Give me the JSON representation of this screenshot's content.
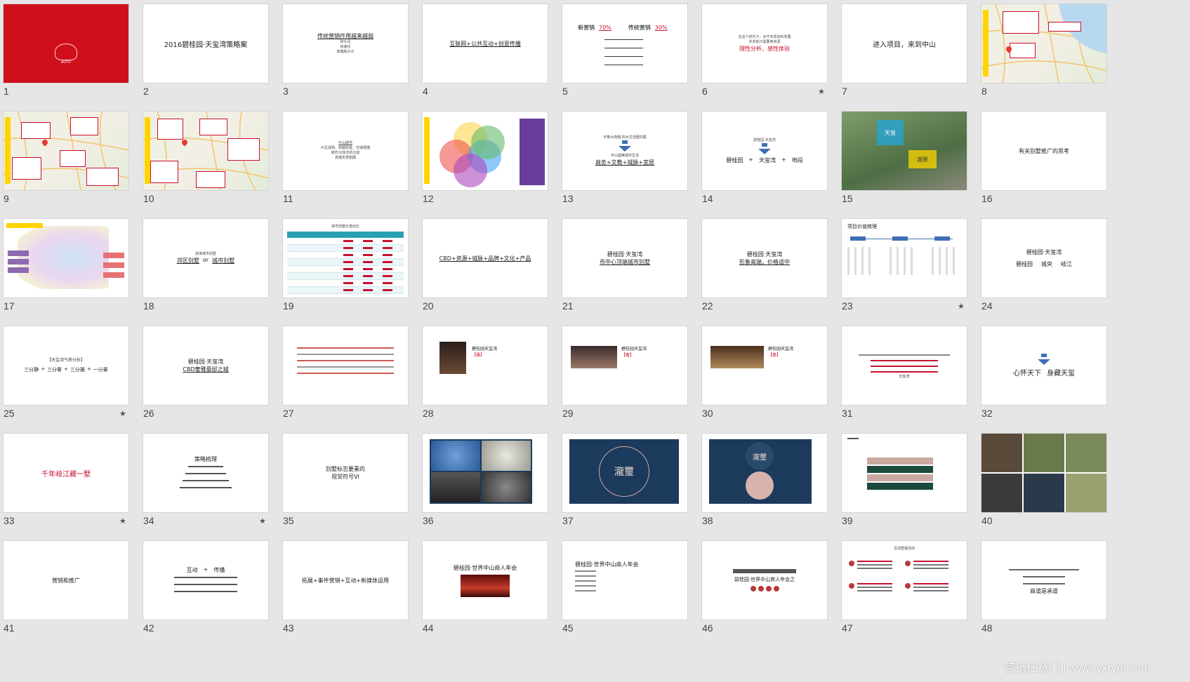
{
  "watermark": "营销任意门 | www.yxrym.com",
  "colors": {
    "background": "#e6e6e6",
    "red": "#c8102e",
    "navy": "#1c3a5c",
    "accent_blue": "#3f6fb5"
  },
  "slides": [
    {
      "n": "1",
      "lines": [
        "AUTO"
      ],
      "star": ""
    },
    {
      "n": "2",
      "lines": [
        "2016碧桂园·天玺湾策略案"
      ],
      "star": ""
    },
    {
      "n": "3",
      "lines": [
        "传统营销作用越来越弱",
        "碎片化",
        "快速化",
        "高端和大众"
      ],
      "star": ""
    },
    {
      "n": "4",
      "lines": [
        "互联网+公共互动+创意传播"
      ],
      "star": ""
    },
    {
      "n": "5",
      "lines": [
        "新营销",
        "70%",
        "传统营销",
        "30%"
      ],
      "star": ""
    },
    {
      "n": "6",
      "lines": [
        "在这个时代下，对于本项目的发展",
        "并非就只需要卖资源",
        "理性分析，感性体验"
      ],
      "star": "★"
    },
    {
      "n": "7",
      "lines": [
        "进入项目，来到中山"
      ],
      "star": ""
    },
    {
      "n": "8",
      "lines": [],
      "star": ""
    },
    {
      "n": "9",
      "lines": [],
      "star": ""
    },
    {
      "n": "10",
      "lines": [],
      "star": ""
    },
    {
      "n": "11",
      "lines": [
        "中山城市",
        "片区成熟、商圈完善、交通便捷",
        "城市10多年的沉淀",
        "高端无限拓展"
      ],
      "star": ""
    },
    {
      "n": "12",
      "lines": [],
      "star": ""
    },
    {
      "n": "13",
      "lines": [
        "平衡大商圈·四大生活圈交集",
        "中山首席城市生活",
        "商务+文教+城脉+宜居"
      ],
      "star": ""
    },
    {
      "n": "14",
      "lines": [
        "碧桂园·天玺湾",
        "碧桂园",
        "+",
        "天玺湾",
        "+",
        "地段"
      ],
      "star": ""
    },
    {
      "n": "15",
      "lines": [
        "天玺",
        "湖景"
      ],
      "star": ""
    },
    {
      "n": "16",
      "lines": [
        "有关别墅推广的思考"
      ],
      "star": ""
    },
    {
      "n": "17",
      "lines": [],
      "star": ""
    },
    {
      "n": "18",
      "lines": [
        "找准城市别墅",
        "郊区别墅",
        "or",
        "城市别墅"
      ],
      "star": ""
    },
    {
      "n": "19",
      "lines": [
        "城市别墅价值对比"
      ],
      "star": ""
    },
    {
      "n": "20",
      "lines": [
        "CBD+资源+城脉+品牌+文化+产品"
      ],
      "star": ""
    },
    {
      "n": "21",
      "lines": [
        "碧桂园·天玺湾",
        "市中心顶端城市别墅"
      ],
      "star": ""
    },
    {
      "n": "22",
      "lines": [
        "碧桂园·天玺湾",
        "形象高端，价格适中"
      ],
      "star": ""
    },
    {
      "n": "23",
      "lines": [
        "项目价值梳理"
      ],
      "star": "★"
    },
    {
      "n": "24",
      "lines": [
        "碧桂园·天玺湾",
        "碧桂园",
        "城央",
        "岐江"
      ],
      "star": ""
    },
    {
      "n": "25",
      "lines": [
        "【天玺湾气质分析】",
        "三分静",
        "+",
        "三分奢",
        "+",
        "三分雅",
        "+",
        "一分豪"
      ],
      "star": "★"
    },
    {
      "n": "26",
      "lines": [
        "碧桂园·天玺湾",
        "CBD奢雅豪邸之城"
      ],
      "star": ""
    },
    {
      "n": "27",
      "lines": [],
      "star": ""
    },
    {
      "n": "28",
      "lines": [
        "碧桂园天玺湾",
        "【雅】"
      ],
      "star": ""
    },
    {
      "n": "29",
      "lines": [
        "碧桂园天玺湾",
        "【奢】"
      ],
      "star": ""
    },
    {
      "n": "30",
      "lines": [
        "碧桂园天玺湾",
        "【豪】"
      ],
      "star": ""
    },
    {
      "n": "31",
      "lines": [
        "天玺湾"
      ],
      "star": ""
    },
    {
      "n": "32",
      "lines": [
        "心怀天下",
        "身藏天玺"
      ],
      "star": ""
    },
    {
      "n": "33",
      "lines": [
        "千年岐江藏一墅"
      ],
      "star": "★"
    },
    {
      "n": "34",
      "lines": [
        "策略梳理"
      ],
      "star": "★"
    },
    {
      "n": "35",
      "lines": [
        "别墅标志要素的",
        "视觉符号VI"
      ],
      "star": ""
    },
    {
      "n": "36",
      "lines": [],
      "star": ""
    },
    {
      "n": "37",
      "lines": [
        "瀧璽"
      ],
      "star": ""
    },
    {
      "n": "38",
      "lines": [
        "瀧璽"
      ],
      "star": ""
    },
    {
      "n": "39",
      "lines": [],
      "star": ""
    },
    {
      "n": "40",
      "lines": [],
      "star": ""
    },
    {
      "n": "41",
      "lines": [
        "营销和推广"
      ],
      "star": ""
    },
    {
      "n": "42",
      "lines": [
        "互动",
        "+",
        "传播"
      ],
      "star": ""
    },
    {
      "n": "43",
      "lines": [
        "拓展+事件营销+互动+新媒体运用"
      ],
      "star": ""
    },
    {
      "n": "44",
      "lines": [
        "碧桂园·世界中山商人年会"
      ],
      "star": ""
    },
    {
      "n": "45",
      "lines": [
        "碧桂园·世界中山商人年会"
      ],
      "star": ""
    },
    {
      "n": "46",
      "lines": [
        "碧桂园·世界中山商人年会之"
      ],
      "star": ""
    },
    {
      "n": "47",
      "lines": [
        "互动营销活动"
      ],
      "star": ""
    },
    {
      "n": "48",
      "lines": [
        "商道是承道"
      ],
      "star": ""
    }
  ]
}
